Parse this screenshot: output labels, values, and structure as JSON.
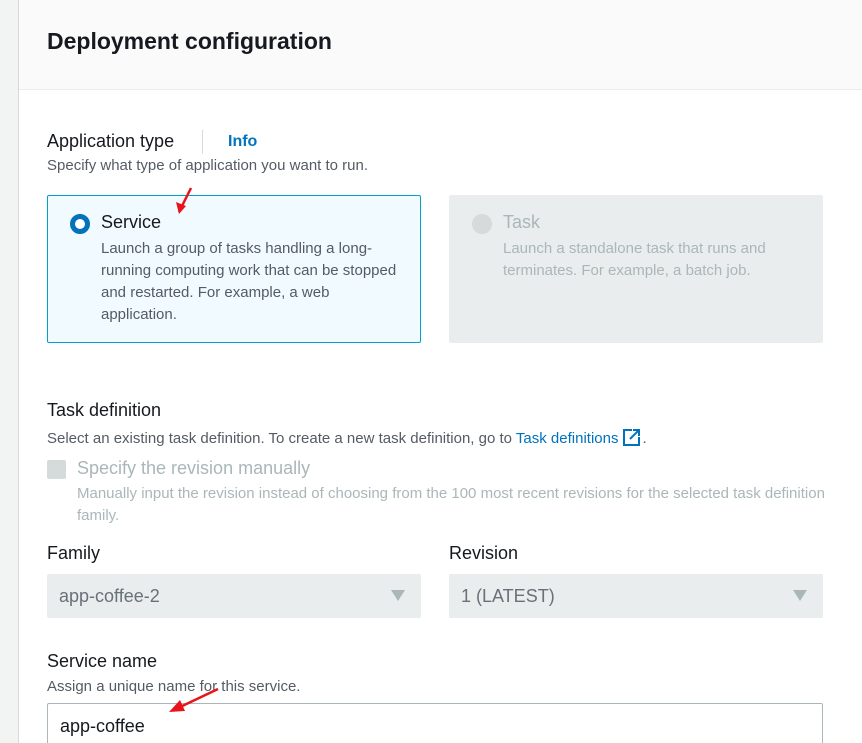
{
  "header": {
    "title": "Deployment configuration"
  },
  "application_type": {
    "label": "Application type",
    "info": "Info",
    "description": "Specify what type of application you want to run.",
    "options": [
      {
        "title": "Service",
        "description": "Launch a group of tasks handling a long-running computing work that can be stopped and restarted. For example, a web application.",
        "selected": true
      },
      {
        "title": "Task",
        "description": "Launch a standalone task that runs and terminates. For example, a batch job.",
        "selected": false
      }
    ]
  },
  "task_definition": {
    "label": "Task definition",
    "description_prefix": "Select an existing task definition. To create a new task definition, go to ",
    "link": "Task definitions",
    "description_suffix": ".",
    "manual_revision": {
      "label": "Specify the revision manually",
      "description": "Manually input the revision instead of choosing from the 100 most recent revisions for the selected task definition family.",
      "checked": false
    }
  },
  "family": {
    "label": "Family",
    "value": "app-coffee-2"
  },
  "revision": {
    "label": "Revision",
    "value": "1 (LATEST)"
  },
  "service_name": {
    "label": "Service name",
    "description": "Assign a unique name for this service.",
    "value": "app-coffee"
  },
  "colors": {
    "accent": "#0073bb",
    "selected_border": "#00a1c9",
    "annotation_arrow": "#e8131b"
  },
  "icons": [
    "external-link-icon",
    "dropdown-caret-icon",
    "annotation-arrow"
  ]
}
